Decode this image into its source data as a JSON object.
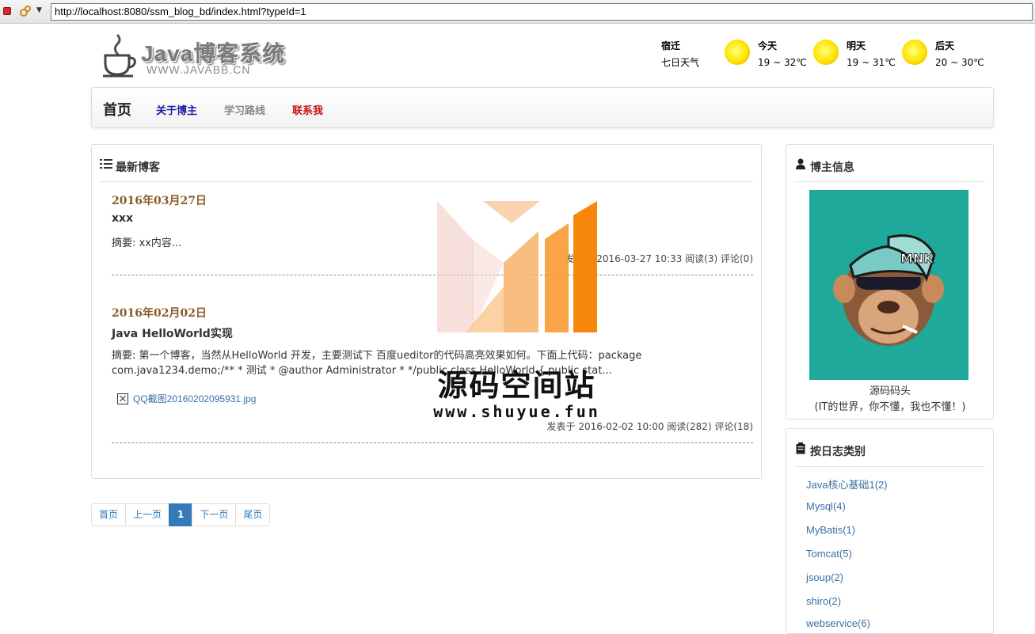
{
  "browser": {
    "url": "http://localhost:8080/ssm_blog_bd/index.html?typeId=1"
  },
  "header": {
    "logo_title": "Java博客系统",
    "logo_subtitle": "WWW.JAVABB.CN",
    "weather": {
      "city": "宿迁",
      "label": "七日天气",
      "days": [
        {
          "name": "今天",
          "temp": "19 ~ 32℃"
        },
        {
          "name": "明天",
          "temp": "19 ~ 31℃"
        },
        {
          "name": "后天",
          "temp": "20 ~ 30℃"
        }
      ]
    }
  },
  "nav": {
    "brand": "首页",
    "links": [
      {
        "label": "关于博主",
        "color": "#1a1aa6"
      },
      {
        "label": "学习路线",
        "color": "#888888"
      },
      {
        "label": "联系我",
        "color": "#cc1111"
      }
    ]
  },
  "main": {
    "title": "最新博客",
    "blogs": [
      {
        "date": "2016年03月27日",
        "title": "xxx",
        "summary": "摘要: xx内容...",
        "info": "发表于 2016-03-27 10:33 阅读(3) 评论(0)"
      },
      {
        "date": "2016年02月02日",
        "title": "Java HelloWorld实现",
        "summary_line1": "摘要: 第一个博客，当然从HelloWorld 开发，主要测试下 百度ueditor的代码高亮效果如何。下面上代码：package",
        "summary_line2": "com.java1234.demo;/** * 测试 * @author Administrator * */public class HelloWorld { public stat...",
        "image_alt": "QQ截图20160202095931.jpg",
        "info": "发表于 2016-02-02 10:00 阅读(282) 评论(18)"
      }
    ]
  },
  "pagination": {
    "first": "首页",
    "prev": "上一页",
    "current": "1",
    "next": "下一页",
    "last": "尾页"
  },
  "sidebar": {
    "owner_title": "博主信息",
    "owner_name": "源码码头",
    "owner_motto": "(IT的世界，你不懂，我也不懂！)",
    "categories_title": "按日志类别",
    "categories": [
      "Java核心基础1(2)",
      "Mysql(4)",
      "MyBatis(1)",
      "Tomcat(5)",
      "jsoup(2)",
      "shiro(2)",
      "webservice(6)"
    ]
  },
  "watermark": {
    "text": "源码空间站",
    "url": "www.shuyue.fun"
  },
  "colors": {
    "accent": "#337ab7",
    "date": "#8b5a2b",
    "avatar_bg": "#1ea99a"
  }
}
